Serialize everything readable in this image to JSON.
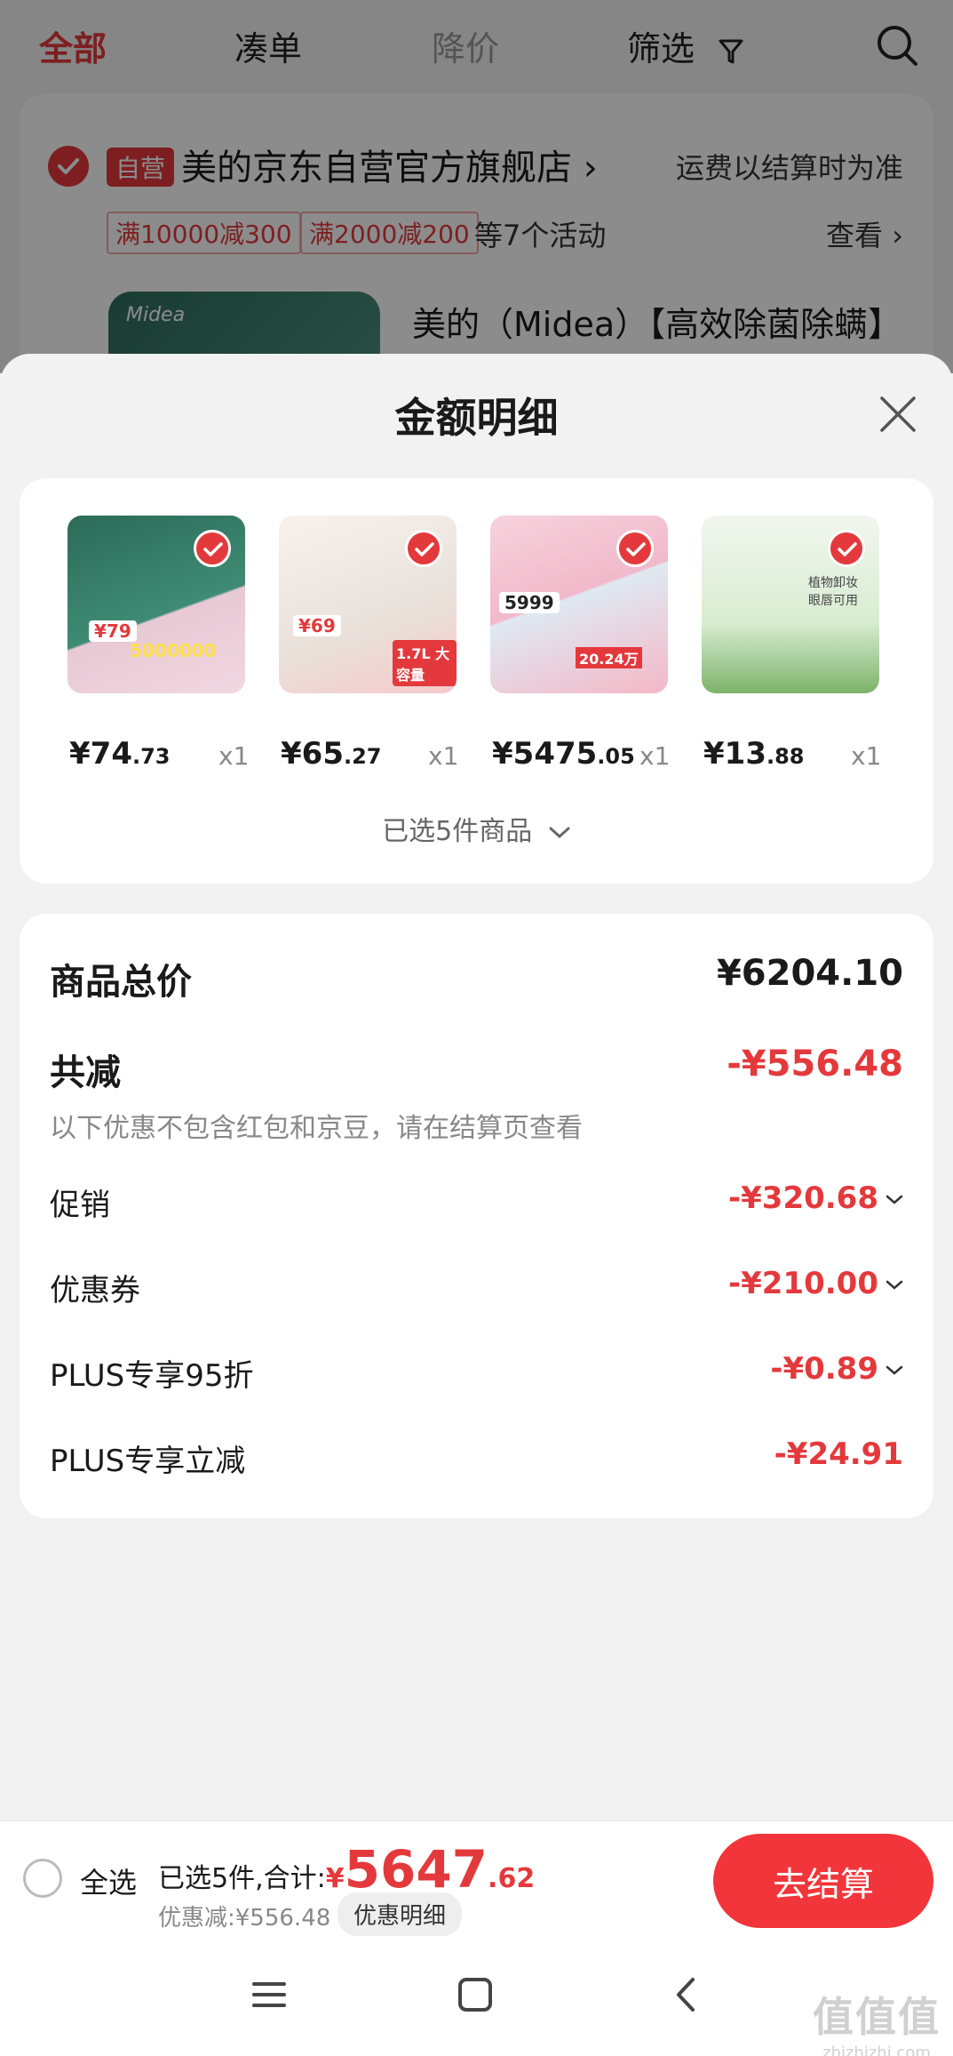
{
  "top_tabs": [
    {
      "label": "全部"
    },
    {
      "label": "凑单"
    },
    {
      "label": "降价"
    },
    {
      "label": "筛选"
    }
  ],
  "store": {
    "badge": "自营",
    "name": "美的京东自营官方旗舰店 ›",
    "shipping_note": "运费以结算时为准",
    "promos": [
      "满10000减300",
      "满2000减200"
    ],
    "activity_count": "等7个活动",
    "view_label": "查看 ›",
    "product_title": "美的（Midea）【高效除菌除螨】",
    "thumb_brand": "Midea"
  },
  "sheet": {
    "title": "金额明细",
    "items": [
      {
        "price_int": "¥74",
        "price_dec": ".73",
        "qty": "x1",
        "chip": "¥79",
        "badge": "5000000"
      },
      {
        "price_int": "¥65",
        "price_dec": ".27",
        "qty": "x1",
        "chip": "¥69",
        "badge": "1.7L 大容量"
      },
      {
        "price_int": "¥5475",
        "price_dec": ".05",
        "qty": "x1",
        "chip": "5999",
        "badge": "20.24万"
      },
      {
        "price_int": "¥13",
        "price_dec": ".88",
        "qty": "x1",
        "chip": "",
        "badge": "植物卸妆 眼唇可用"
      }
    ],
    "selected_count": "已选5件商品"
  },
  "summary": {
    "total_label": "商品总价",
    "total_value": "¥6204.10",
    "reduce_label": "共减",
    "reduce_value": "-¥556.48",
    "reduce_note": "以下优惠不包含红包和京豆，请在结算页查看",
    "rows": [
      {
        "label": "促销",
        "value": "-¥320.68"
      },
      {
        "label": "优惠券",
        "value": "-¥210.00"
      },
      {
        "label": "PLUS专享95折",
        "value": "-¥0.89"
      },
      {
        "label": "PLUS专享立减",
        "value": "-¥24.91"
      }
    ]
  },
  "checkout": {
    "select_all": "全选",
    "sum_prefix": "已选5件,合计:",
    "yen": "¥",
    "sum_int": "5647",
    "sum_frac": ".62",
    "saved": "优惠减:¥556.48",
    "detail_label": "优惠明细",
    "button": "去结算"
  },
  "watermark": {
    "main": "值值值",
    "sub": "zhizhizhi.com"
  },
  "colors": {
    "accent": "#e4393c",
    "button": "#f2353a"
  }
}
